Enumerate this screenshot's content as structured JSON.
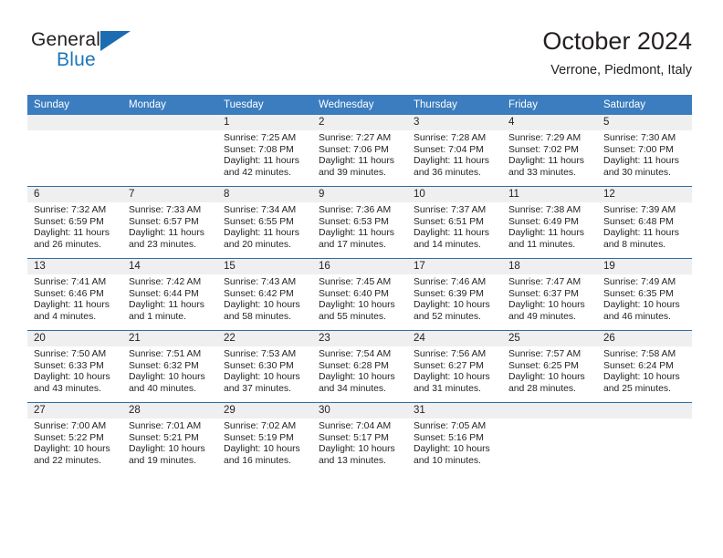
{
  "brand": {
    "name_part1": "General",
    "name_part2": "Blue",
    "flag_icon": "blue-triangle-flag-icon"
  },
  "header": {
    "title": "October 2024",
    "subtitle": "Verrone, Piedmont, Italy"
  },
  "colors": {
    "header_band": "#3b7dbf",
    "row_divider": "#2e6da8",
    "daynum_band": "#efefef",
    "brand_blue": "#1b75bb",
    "text": "#231f20"
  },
  "weekday_headers": [
    "Sunday",
    "Monday",
    "Tuesday",
    "Wednesday",
    "Thursday",
    "Friday",
    "Saturday"
  ],
  "weeks": [
    [
      {
        "day": "",
        "sunrise": "",
        "sunset": "",
        "daylight_1": "",
        "daylight_2": ""
      },
      {
        "day": "",
        "sunrise": "",
        "sunset": "",
        "daylight_1": "",
        "daylight_2": ""
      },
      {
        "day": "1",
        "sunrise": "Sunrise: 7:25 AM",
        "sunset": "Sunset: 7:08 PM",
        "daylight_1": "Daylight: 11 hours",
        "daylight_2": "and 42 minutes."
      },
      {
        "day": "2",
        "sunrise": "Sunrise: 7:27 AM",
        "sunset": "Sunset: 7:06 PM",
        "daylight_1": "Daylight: 11 hours",
        "daylight_2": "and 39 minutes."
      },
      {
        "day": "3",
        "sunrise": "Sunrise: 7:28 AM",
        "sunset": "Sunset: 7:04 PM",
        "daylight_1": "Daylight: 11 hours",
        "daylight_2": "and 36 minutes."
      },
      {
        "day": "4",
        "sunrise": "Sunrise: 7:29 AM",
        "sunset": "Sunset: 7:02 PM",
        "daylight_1": "Daylight: 11 hours",
        "daylight_2": "and 33 minutes."
      },
      {
        "day": "5",
        "sunrise": "Sunrise: 7:30 AM",
        "sunset": "Sunset: 7:00 PM",
        "daylight_1": "Daylight: 11 hours",
        "daylight_2": "and 30 minutes."
      }
    ],
    [
      {
        "day": "6",
        "sunrise": "Sunrise: 7:32 AM",
        "sunset": "Sunset: 6:59 PM",
        "daylight_1": "Daylight: 11 hours",
        "daylight_2": "and 26 minutes."
      },
      {
        "day": "7",
        "sunrise": "Sunrise: 7:33 AM",
        "sunset": "Sunset: 6:57 PM",
        "daylight_1": "Daylight: 11 hours",
        "daylight_2": "and 23 minutes."
      },
      {
        "day": "8",
        "sunrise": "Sunrise: 7:34 AM",
        "sunset": "Sunset: 6:55 PM",
        "daylight_1": "Daylight: 11 hours",
        "daylight_2": "and 20 minutes."
      },
      {
        "day": "9",
        "sunrise": "Sunrise: 7:36 AM",
        "sunset": "Sunset: 6:53 PM",
        "daylight_1": "Daylight: 11 hours",
        "daylight_2": "and 17 minutes."
      },
      {
        "day": "10",
        "sunrise": "Sunrise: 7:37 AM",
        "sunset": "Sunset: 6:51 PM",
        "daylight_1": "Daylight: 11 hours",
        "daylight_2": "and 14 minutes."
      },
      {
        "day": "11",
        "sunrise": "Sunrise: 7:38 AM",
        "sunset": "Sunset: 6:49 PM",
        "daylight_1": "Daylight: 11 hours",
        "daylight_2": "and 11 minutes."
      },
      {
        "day": "12",
        "sunrise": "Sunrise: 7:39 AM",
        "sunset": "Sunset: 6:48 PM",
        "daylight_1": "Daylight: 11 hours",
        "daylight_2": "and 8 minutes."
      }
    ],
    [
      {
        "day": "13",
        "sunrise": "Sunrise: 7:41 AM",
        "sunset": "Sunset: 6:46 PM",
        "daylight_1": "Daylight: 11 hours",
        "daylight_2": "and 4 minutes."
      },
      {
        "day": "14",
        "sunrise": "Sunrise: 7:42 AM",
        "sunset": "Sunset: 6:44 PM",
        "daylight_1": "Daylight: 11 hours",
        "daylight_2": "and 1 minute."
      },
      {
        "day": "15",
        "sunrise": "Sunrise: 7:43 AM",
        "sunset": "Sunset: 6:42 PM",
        "daylight_1": "Daylight: 10 hours",
        "daylight_2": "and 58 minutes."
      },
      {
        "day": "16",
        "sunrise": "Sunrise: 7:45 AM",
        "sunset": "Sunset: 6:40 PM",
        "daylight_1": "Daylight: 10 hours",
        "daylight_2": "and 55 minutes."
      },
      {
        "day": "17",
        "sunrise": "Sunrise: 7:46 AM",
        "sunset": "Sunset: 6:39 PM",
        "daylight_1": "Daylight: 10 hours",
        "daylight_2": "and 52 minutes."
      },
      {
        "day": "18",
        "sunrise": "Sunrise: 7:47 AM",
        "sunset": "Sunset: 6:37 PM",
        "daylight_1": "Daylight: 10 hours",
        "daylight_2": "and 49 minutes."
      },
      {
        "day": "19",
        "sunrise": "Sunrise: 7:49 AM",
        "sunset": "Sunset: 6:35 PM",
        "daylight_1": "Daylight: 10 hours",
        "daylight_2": "and 46 minutes."
      }
    ],
    [
      {
        "day": "20",
        "sunrise": "Sunrise: 7:50 AM",
        "sunset": "Sunset: 6:33 PM",
        "daylight_1": "Daylight: 10 hours",
        "daylight_2": "and 43 minutes."
      },
      {
        "day": "21",
        "sunrise": "Sunrise: 7:51 AM",
        "sunset": "Sunset: 6:32 PM",
        "daylight_1": "Daylight: 10 hours",
        "daylight_2": "and 40 minutes."
      },
      {
        "day": "22",
        "sunrise": "Sunrise: 7:53 AM",
        "sunset": "Sunset: 6:30 PM",
        "daylight_1": "Daylight: 10 hours",
        "daylight_2": "and 37 minutes."
      },
      {
        "day": "23",
        "sunrise": "Sunrise: 7:54 AM",
        "sunset": "Sunset: 6:28 PM",
        "daylight_1": "Daylight: 10 hours",
        "daylight_2": "and 34 minutes."
      },
      {
        "day": "24",
        "sunrise": "Sunrise: 7:56 AM",
        "sunset": "Sunset: 6:27 PM",
        "daylight_1": "Daylight: 10 hours",
        "daylight_2": "and 31 minutes."
      },
      {
        "day": "25",
        "sunrise": "Sunrise: 7:57 AM",
        "sunset": "Sunset: 6:25 PM",
        "daylight_1": "Daylight: 10 hours",
        "daylight_2": "and 28 minutes."
      },
      {
        "day": "26",
        "sunrise": "Sunrise: 7:58 AM",
        "sunset": "Sunset: 6:24 PM",
        "daylight_1": "Daylight: 10 hours",
        "daylight_2": "and 25 minutes."
      }
    ],
    [
      {
        "day": "27",
        "sunrise": "Sunrise: 7:00 AM",
        "sunset": "Sunset: 5:22 PM",
        "daylight_1": "Daylight: 10 hours",
        "daylight_2": "and 22 minutes."
      },
      {
        "day": "28",
        "sunrise": "Sunrise: 7:01 AM",
        "sunset": "Sunset: 5:21 PM",
        "daylight_1": "Daylight: 10 hours",
        "daylight_2": "and 19 minutes."
      },
      {
        "day": "29",
        "sunrise": "Sunrise: 7:02 AM",
        "sunset": "Sunset: 5:19 PM",
        "daylight_1": "Daylight: 10 hours",
        "daylight_2": "and 16 minutes."
      },
      {
        "day": "30",
        "sunrise": "Sunrise: 7:04 AM",
        "sunset": "Sunset: 5:17 PM",
        "daylight_1": "Daylight: 10 hours",
        "daylight_2": "and 13 minutes."
      },
      {
        "day": "31",
        "sunrise": "Sunrise: 7:05 AM",
        "sunset": "Sunset: 5:16 PM",
        "daylight_1": "Daylight: 10 hours",
        "daylight_2": "and 10 minutes."
      },
      {
        "day": "",
        "sunrise": "",
        "sunset": "",
        "daylight_1": "",
        "daylight_2": ""
      },
      {
        "day": "",
        "sunrise": "",
        "sunset": "",
        "daylight_1": "",
        "daylight_2": ""
      }
    ]
  ]
}
